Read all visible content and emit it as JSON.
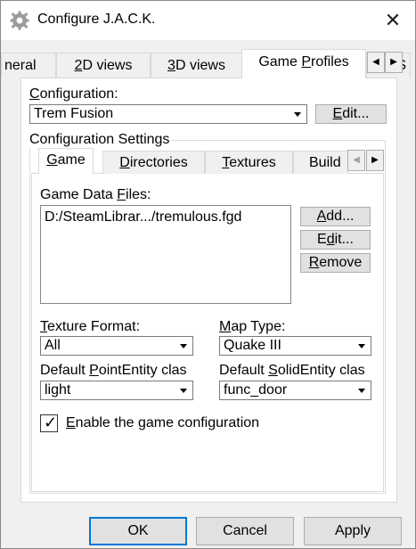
{
  "window": {
    "title": "Configure J.A.C.K.",
    "close_glyph": "✕",
    "app_icon": "gear-icon"
  },
  "outer_tabs": [
    {
      "label": "neral"
    },
    {
      "label_pre": "",
      "label_u": "2",
      "label_post": "D views"
    },
    {
      "label_pre": "",
      "label_u": "3",
      "label_post": "D views"
    },
    {
      "label_pre": "Game ",
      "label_u": "P",
      "label_post": "rofiles"
    },
    {
      "label": "S"
    }
  ],
  "outer_tab_scroll": {
    "left": "◀",
    "right": "▶"
  },
  "configuration": {
    "label_pre": "",
    "label_u": "C",
    "label_post": "onfiguration:",
    "selected": "Trem Fusion",
    "edit_pre": "",
    "edit_u": "E",
    "edit_post": "dit..."
  },
  "settings": {
    "group_label": "Configuration Settings",
    "tabs": [
      {
        "pre": "",
        "u": "G",
        "post": "ame"
      },
      {
        "pre": "",
        "u": "D",
        "post": "irectories"
      },
      {
        "pre": "",
        "u": "T",
        "post": "extures"
      },
      {
        "pre": "Buil",
        "u": "",
        "post": "d"
      }
    ],
    "tab_scroll": {
      "left": "◀",
      "right": "▶"
    },
    "game_data_files": {
      "label_pre": "Game Data ",
      "label_u": "F",
      "label_post": "iles:",
      "items": [
        "D:/SteamLibrar.../tremulous.fgd"
      ],
      "add_pre": "",
      "add_u": "A",
      "add_post": "dd...",
      "edit_pre": "E",
      "edit_u": "d",
      "edit_post": "it...",
      "remove_pre": "",
      "remove_u": "R",
      "remove_post": "emove"
    },
    "texture_format": {
      "label_pre": "",
      "label_u": "T",
      "label_post": "exture Format:",
      "selected": "All"
    },
    "map_type": {
      "label_pre": "",
      "label_u": "M",
      "label_post": "ap Type:",
      "selected": "Quake III"
    },
    "default_point": {
      "label_pre": "Default ",
      "label_u": "P",
      "label_post": "ointEntity clas",
      "selected": "light"
    },
    "default_solid": {
      "label_pre": "Default ",
      "label_u": "S",
      "label_post": "olidEntity clas",
      "selected": "func_door"
    },
    "enable": {
      "checked": true,
      "check_glyph": "✓",
      "label_pre": "",
      "label_u": "E",
      "label_post": "nable the game configuration"
    }
  },
  "buttons": {
    "ok": "OK",
    "cancel": "Cancel",
    "apply": "Apply"
  }
}
